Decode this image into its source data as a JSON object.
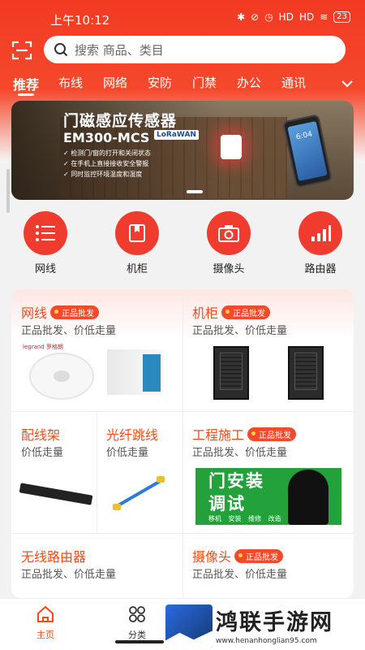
{
  "status_bar": {
    "time": "上午10:12",
    "battery": "23",
    "signal1": "HD",
    "signal2": "HD"
  },
  "search": {
    "placeholder": "搜索 商品、类目"
  },
  "tabs": [
    "推荐",
    "布线",
    "网络",
    "安防",
    "门禁",
    "办公",
    "通讯"
  ],
  "banner": {
    "title": "门磁感应传感器",
    "model": "EM300-MCS",
    "badge": "LoRaWAN",
    "points": [
      "检测门/窗的打开和关闭状态",
      "在手机上直接接收安全警报",
      "同时监控环境温度和湿度"
    ],
    "phone_time": "6:04"
  },
  "categories": [
    {
      "label": "网线",
      "icon": "list-icon"
    },
    {
      "label": "机柜",
      "icon": "book-icon"
    },
    {
      "label": "摄像头",
      "icon": "camera-icon"
    },
    {
      "label": "路由器",
      "icon": "signal-bars-icon"
    }
  ],
  "cards": {
    "cable": {
      "title": "网线",
      "badge": "正品批发",
      "subtitle": "正品批发、价低走量",
      "brand": "legrand 罗格朗"
    },
    "cabinet": {
      "title": "机柜",
      "badge": "正品批发",
      "subtitle": "正品批发、价低走量"
    },
    "patch": {
      "title": "配线架",
      "subtitle": "价低走量"
    },
    "fiber": {
      "title": "光纤跳线",
      "subtitle": "价低走量"
    },
    "engineering": {
      "title": "工程施工",
      "badge": "正品批发",
      "subtitle": "正品批发、价低走量",
      "banner_title": "门安装\n调试",
      "banner_foot": "移机 安装 维修 改造"
    },
    "router": {
      "title": "无线路由器",
      "subtitle": "正品批发、价低走量"
    },
    "camera": {
      "title": "摄像头",
      "badge": "正品批发",
      "subtitle": "正品批发、价低走量"
    }
  },
  "bottom_nav": [
    {
      "label": "主页",
      "icon": "home-icon",
      "active": true
    },
    {
      "label": "分类",
      "icon": "grid-icon",
      "active": false
    }
  ],
  "watermark": {
    "title": "鸿联手游网",
    "url": "www.henanhonglian95.com"
  },
  "colors": {
    "brand_red": "#f23a22",
    "accent_orange": "#f04c1a",
    "badge_red": "#f24a2a",
    "green_banner": "#23a13a"
  }
}
